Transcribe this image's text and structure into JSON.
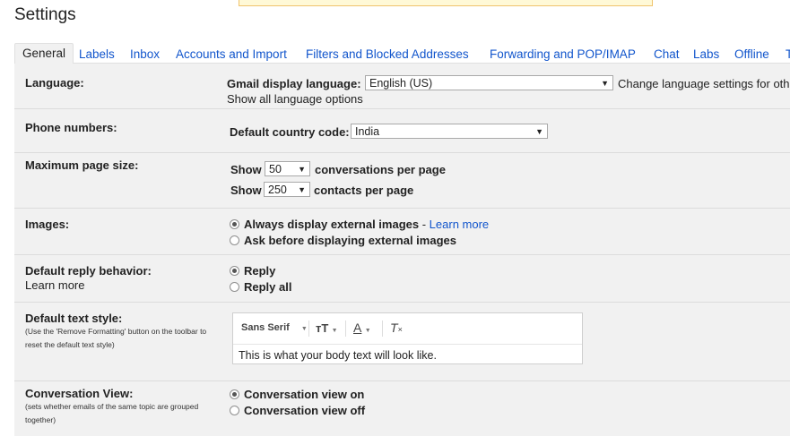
{
  "page": {
    "title": "Settings"
  },
  "tabs": [
    {
      "label": "General",
      "active": true
    },
    {
      "label": "Labels"
    },
    {
      "label": "Inbox"
    },
    {
      "label": "Accounts and Import"
    },
    {
      "label": "Filters and Blocked Addresses"
    },
    {
      "label": "Forwarding and POP/IMAP"
    },
    {
      "label": "Chat"
    },
    {
      "label": "Labs"
    },
    {
      "label": "Offline"
    },
    {
      "label": "T"
    }
  ],
  "language": {
    "label": "Language:",
    "display_label": "Gmail display language:",
    "selected": "English (US)",
    "change_link": "Change language settings for othe",
    "show_all_link": "Show all language options"
  },
  "phone": {
    "label": "Phone numbers:",
    "country_label": "Default country code:",
    "selected": "India"
  },
  "page_size": {
    "label": "Maximum page size:",
    "show_label": "Show",
    "conversations_value": "50",
    "conversations_suffix": "conversations per page",
    "contacts_value": "250",
    "contacts_suffix": "contacts per page"
  },
  "images": {
    "label": "Images:",
    "option_always": "Always display external images",
    "separator": " - ",
    "learn_more": "Learn more",
    "option_ask": "Ask before displaying external images",
    "selected": "always"
  },
  "reply": {
    "label": "Default reply behavior:",
    "learn_more": "Learn more",
    "option_reply": "Reply",
    "option_reply_all": "Reply all",
    "selected": "reply"
  },
  "text_style": {
    "label": "Default text style:",
    "hint": "(Use the 'Remove Formatting' button on the toolbar to reset the default text style)",
    "font_name": "Sans Serif",
    "preview": "This is what your body text will look like."
  },
  "conversation": {
    "label": "Conversation View:",
    "hint": "(sets whether emails of the same topic are grouped together)",
    "option_on": "Conversation view on",
    "option_off": "Conversation view off",
    "selected": "on"
  },
  "icons": {
    "dropdown": "chevron-down-icon",
    "font_size": "font-size-icon",
    "text_color": "text-color-icon",
    "remove_formatting": "remove-formatting-icon"
  },
  "colors": {
    "link": "#1155cc",
    "panel": "#f1f1f1",
    "notice": "#fff9d7"
  }
}
